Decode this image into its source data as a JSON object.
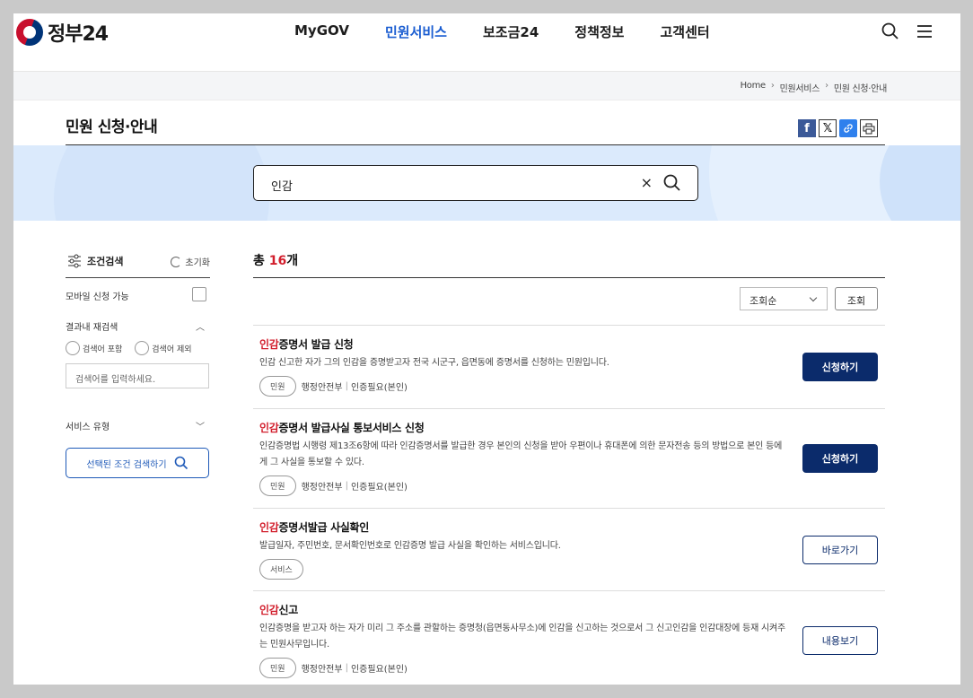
{
  "brand": {
    "name": "정부24"
  },
  "nav": {
    "items": [
      "MyGOV",
      "민원서비스",
      "보조금24",
      "정책정보",
      "고객센터"
    ],
    "active_index": 1
  },
  "breadcrumb": [
    "Home",
    "민원서비스",
    "민원 신청·안내"
  ],
  "page": {
    "title": "민원 신청·안내"
  },
  "search": {
    "value": "인감",
    "clear_symbol": "×"
  },
  "filter": {
    "title": "조건검색",
    "reset_label": "초기화",
    "mobile_label": "모바일 신청 가능",
    "refine_label": "결과내 재검색",
    "radio_include": "검색어 포함",
    "radio_exclude": "검색어 제외",
    "refine_placeholder": "검색어를 입력하세요.",
    "service_type_label": "서비스 유형",
    "submit_label": "선택된 조건 검색하기"
  },
  "results": {
    "count_prefix": "총 ",
    "count": "16",
    "count_suffix": "개",
    "sort_value": "조회순",
    "sort_button": "조회",
    "items": [
      {
        "highlight": "인감",
        "rest": "증명서 발급 신청",
        "desc": "인감 신고한 자가 그의 인감을 증명받고자 전국 시군구, 읍면동에 증명서를 신청하는 민원입니다.",
        "tag": "민원",
        "org": "행정안전부",
        "auth": "인증필요(본인)",
        "action": "신청하기",
        "style": "primary"
      },
      {
        "highlight": "인감",
        "rest": "증명서 발급사실 통보서비스 신청",
        "desc": "인감증명법 시행령 제13조6항에 따라 인감증명서를 발급한 경우 본인의 신청을 받아 우편이나 휴대폰에 의한 문자전송 등의 방법으로 본인 등에게 그 사실을 통보할 수 있다.",
        "tag": "민원",
        "org": "행정안전부",
        "auth": "인증필요(본인)",
        "action": "신청하기",
        "style": "primary"
      },
      {
        "highlight": "인감",
        "rest": "증명서발급 사실확인",
        "desc": "발급일자, 주민번호, 문서확인번호로 인감증명 발급 사실을 확인하는 서비스입니다.",
        "tag": "서비스",
        "org": "",
        "auth": "",
        "action": "바로가기",
        "style": "outline"
      },
      {
        "highlight": "인감",
        "rest": "신고",
        "desc": "인감증명을 받고자 하는 자가 미리 그 주소를 관할하는 증명청(읍면동사무소)에 인감을 신고하는 것으로서 그 신고인감을 인감대장에 등재 시켜주는 민원사무입니다.",
        "tag": "민원",
        "org": "행정안전부",
        "auth": "인증필요(본인)",
        "action": "내용보기",
        "style": "outline"
      }
    ]
  },
  "colors": {
    "accent": "#1a5dd1",
    "highlight": "#d21f2d",
    "primary_button": "#0b2b6b",
    "band": "#dbeafc"
  },
  "icons": [
    "search-icon",
    "menu-icon",
    "facebook-icon",
    "x-icon",
    "link-icon",
    "print-icon",
    "filter-icon",
    "refresh-icon"
  ]
}
